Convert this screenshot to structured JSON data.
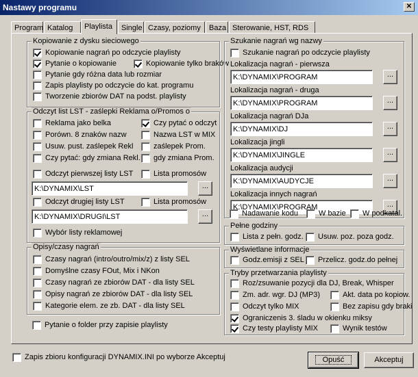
{
  "window": {
    "title": "Nastawy programu"
  },
  "tabs": [
    "Program",
    "Katalog",
    "Playlista",
    "Single",
    "Czasy, poziomy",
    "Baza",
    "Sterowanie, HST, RDS"
  ],
  "kopiowanie": {
    "title": "Kopiowanie z dysku sieciowego",
    "items": [
      {
        "label": "Kopiowanie nagrań po odczycie playlisty",
        "checked": true
      },
      {
        "label": "Pytanie o kopiowanie",
        "checked": true
      },
      {
        "label": "Kopiowanie tylko braków",
        "checked": true
      },
      {
        "label": "Pytanie gdy różna data lub rozmiar",
        "checked": false
      },
      {
        "label": "Zapis playlisty po odczycie do kat. programu",
        "checked": false
      },
      {
        "label": "Tworzenie zbiorów DAT na podst. playlisty",
        "checked": false
      }
    ]
  },
  "odczyt": {
    "title": "Odczyt list LST - zaślepki Reklama o/Promos o",
    "items": [
      {
        "label": "Reklama jako belka",
        "checked": false
      },
      {
        "label": "Czy pytać o odczyt",
        "checked": true
      },
      {
        "label": "Porówn. 8 znaków nazw",
        "checked": false
      },
      {
        "label": "Nazwa LST w MIX",
        "checked": false
      },
      {
        "label": "Usuw. pust. zaślepek Rekl",
        "checked": false
      },
      {
        "label": "zaślepek Prom.",
        "checked": false
      },
      {
        "label": "Czy pytać: gdy zmiana Rekl.",
        "checked": false
      },
      {
        "label": "gdy zmiana Prom.",
        "checked": false
      },
      {
        "label": "Odczyt pierwszej listy LST",
        "checked": false
      },
      {
        "label": "Lista promosów",
        "checked": false
      },
      {
        "label": "Odczyt drugiej listy LST",
        "checked": false
      },
      {
        "label": "Lista promosów",
        "checked": false
      },
      {
        "label": "Wybór listy reklamowej",
        "checked": false
      }
    ],
    "path1": "K:\\DYNAMIX\\LST",
    "path2": "K:\\DYNAMIX\\DRUGI\\LST"
  },
  "opisy": {
    "title": "Opisy/czasy nagrań",
    "items": [
      {
        "label": "Czasy nagrań (intro/outro/mix/z) z listy SEL",
        "checked": false
      },
      {
        "label": "Domyślne czasy FOut, Mix i NKon",
        "checked": false
      },
      {
        "label": "Czasy nagrań ze zbiorów DAT - dla listy SEL",
        "checked": false
      },
      {
        "label": "Opisy nagrań ze zbiorów DAT - dla listy SEL",
        "checked": false
      },
      {
        "label": "Kategorie elem. ze zb. DAT - dla listy SEL",
        "checked": false
      }
    ]
  },
  "folder": {
    "label": "Pytanie o folder przy zapisie playlisty",
    "checked": false
  },
  "szukanie": {
    "title": "Szukanie nagrań wg nazwy",
    "check": {
      "label": "Szukanie nagrań po odczycie playlisty",
      "checked": false
    },
    "locations": [
      {
        "label": "Lokalizacja nagrań - pierwsza",
        "value": "K:\\DYNAMIX\\PROGRAM"
      },
      {
        "label": "Lokalizacja nagrań - druga",
        "value": "K:\\DYNAMIX\\PROGRAM"
      },
      {
        "label": "Lokalizacja nagrań DJa",
        "value": "K:\\DYNAMIX\\DJ"
      },
      {
        "label": "Lokalizacja jingli",
        "value": "K:\\DYNAMIX\\JINGLE"
      },
      {
        "label": "Lokalizacja audycji",
        "value": "K:\\DYNAMIX\\AUDYCJE"
      },
      {
        "label": "Lokalizacja innych nagrań",
        "value": "K:\\DYNAMIX\\PROGRAM"
      }
    ],
    "bottom": [
      {
        "label": "Nadawanie kodu",
        "checked": false
      },
      {
        "label": "W bazie",
        "checked": false
      },
      {
        "label": "W podkatal.",
        "checked": false
      }
    ],
    "dots": "..."
  },
  "pelne": {
    "title": "Pełne godziny",
    "items": [
      {
        "label": "Lista z pełn. godz.",
        "checked": false
      },
      {
        "label": "Usuw. poz. poza godz.",
        "checked": false
      }
    ]
  },
  "wyswietlane": {
    "title": "Wyświetlane informacje",
    "items": [
      {
        "label": "Godz.emisji z SEL",
        "checked": false
      },
      {
        "label": "Przelicz. godz.do pełnej",
        "checked": false
      }
    ]
  },
  "tryby": {
    "title": "Tryby przetwarzania playlisty",
    "items": [
      {
        "label": "Roz/zsuwanie pozycji dla DJ, Break, Whisper",
        "checked": false
      },
      {
        "label": "Zm. adr. wgr. DJ (MP3)",
        "checked": false
      },
      {
        "label": "Akt. data po kopiow.",
        "checked": false
      },
      {
        "label": "Odczyt tylko MIX",
        "checked": false
      },
      {
        "label": "Bez zapisu gdy braki",
        "checked": false
      },
      {
        "label": "Ograniczenis 3. śladu w okienku miksy",
        "checked": true
      },
      {
        "label": "Czy testy playlisty MIX",
        "checked": true
      },
      {
        "label": "Wynik testów",
        "checked": false
      }
    ]
  },
  "footer": {
    "zapis": {
      "label": "Zapis zbioru konfiguracji DYNAMIX.INI po wyborze Akceptuj",
      "checked": false
    },
    "cancel": "Opuść",
    "accept": "Akceptuj"
  }
}
